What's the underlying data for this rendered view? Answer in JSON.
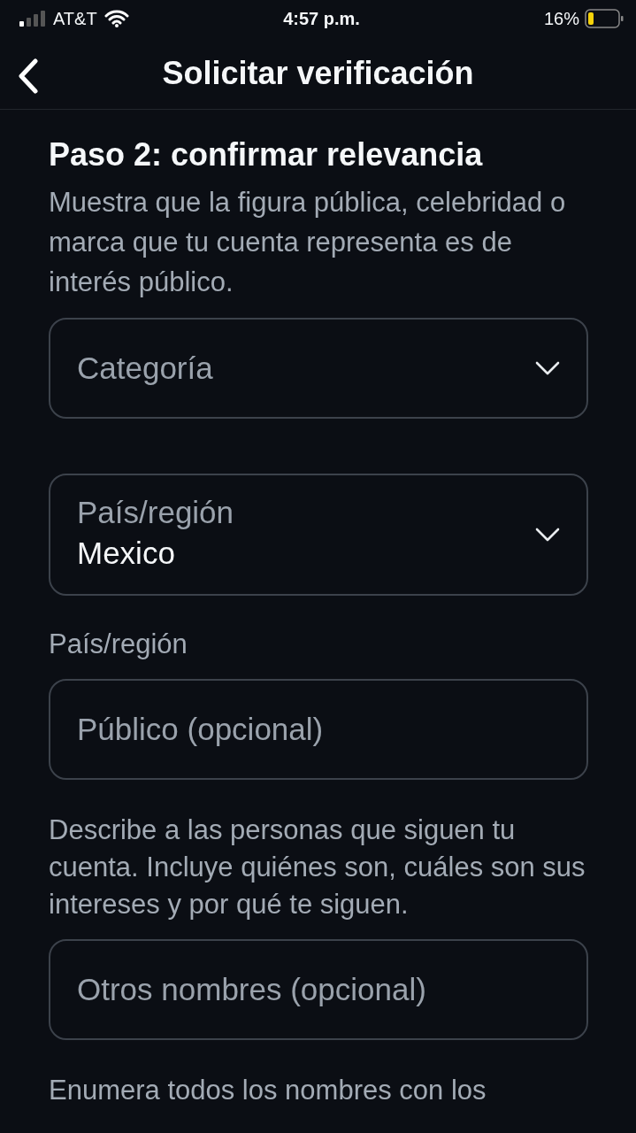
{
  "status_bar": {
    "carrier": "AT&T",
    "time": "4:57 p.m.",
    "battery": "16%"
  },
  "header": {
    "title": "Solicitar verificación"
  },
  "step": {
    "title": "Paso 2: confirmar relevancia",
    "description": "Muestra que la figura pública, celebridad o marca que tu cuenta representa es de interés público."
  },
  "form": [
    {
      "kind": "select",
      "label": "Categoría"
    },
    {
      "kind": "select",
      "label": "País/región",
      "value": "Mexico"
    },
    {
      "kind": "hint",
      "text": "País/región"
    },
    {
      "kind": "input",
      "placeholder": "Público (opcional)"
    },
    {
      "kind": "hint",
      "text": "Describe a las personas que siguen tu cuenta. Incluye quiénes son, cuáles son sus intereses y por qué te siguen."
    },
    {
      "kind": "input",
      "placeholder": "Otros nombres (opcional)"
    },
    {
      "kind": "hint",
      "text": "Enumera todos los nombres con los"
    }
  ]
}
